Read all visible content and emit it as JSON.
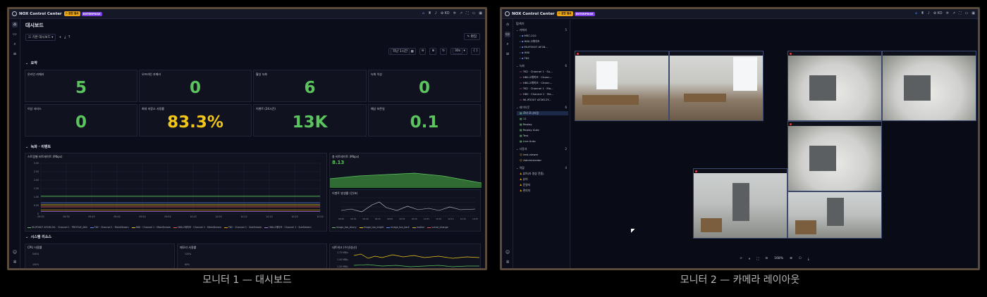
{
  "captions": {
    "monitor1": "모니터 1 — 대시보드",
    "monitor2": "모니터 2 — 카메라 레이아웃"
  },
  "app": {
    "title": "NOX Control Center",
    "badge_warn": "⚠ 권한 필요",
    "badge_edition": "ENTERPRISE",
    "lang": "KO"
  },
  "dashboard": {
    "title": "대시보드",
    "dashboard_select": "기본 대시보드",
    "edit_label": "편집",
    "time_range": "지난 1시간",
    "refresh": "30s",
    "sections": {
      "summary": "요약",
      "recording_events": "녹화 · 이벤트",
      "system_resources": "시스템 리소스"
    },
    "stats": [
      {
        "title": "온라인 카메라",
        "value": "5",
        "color": "green"
      },
      {
        "title": "오프라인 카메라",
        "value": "0",
        "color": "green"
      },
      {
        "title": "활성 녹화",
        "value": "6",
        "color": "green"
      },
      {
        "title": "녹화 이상",
        "value": "0",
        "color": "green"
      },
      {
        "title": "이상 서비스",
        "value": "0",
        "color": "green"
      },
      {
        "title": "최대 저장소 사용률",
        "value": "83.3%",
        "color": "yellow"
      },
      {
        "title": "이벤트 (24시간)",
        "value": "13K",
        "color": "green"
      },
      {
        "title": "예상 보존일",
        "value": "0.1",
        "color": "green"
      }
    ],
    "panels": {
      "stream_bitrate": "스트림별 비트레이트 (Mbps)",
      "total_bitrate": "총 비트레이트 (Mbps)",
      "total_bitrate_value": "8.13",
      "event_rate": "이벤트 발생률 (건/초)",
      "cpu": "CPU 사용률",
      "memory": "메모리 사용률",
      "net": "네트워크 (수신/송신)"
    },
    "bitrate_yticks": [
      "3.00",
      "2.50",
      "2.00",
      "1.50",
      "1.00",
      "0.50",
      "0"
    ],
    "time_ticks": [
      "09:30",
      "09:35",
      "09:40",
      "09:45",
      "09:50",
      "09:55",
      "10:00",
      "10:05",
      "10:10",
      "10:15",
      "10:20",
      "10:25"
    ],
    "event_time_ticks": [
      "09:30",
      "09:35",
      "09:40",
      "09:45",
      "09:50",
      "09:55",
      "10:00",
      "10:05",
      "10:10",
      "10:15",
      "10:20",
      "10:25"
    ],
    "stream_legend": [
      {
        "name": "MI-IP2007 AF2812VL · Channel 1 · PROFILE_000",
        "color": "#5cc45e"
      },
      {
        "name": "T62 · Channel 1 · MainStream",
        "color": "#5b8def"
      },
      {
        "name": "H80 · Channel 1 · MainStream",
        "color": "#f2c618"
      },
      {
        "name": "H80-2채미조 · Channel 1 · MainStream",
        "color": "#e05a5a"
      },
      {
        "name": "T62 · Channel 1 · SubStream",
        "color": "#e8a317"
      },
      {
        "name": "H80-2채미조 · Channel 1 · SubStream",
        "color": "#b072e8"
      }
    ],
    "event_legend": [
      {
        "name": "image_too_blurry",
        "color": "#5cc45e"
      },
      {
        "name": "image_too_bright",
        "color": "#f2c618"
      },
      {
        "name": "image_too_dark",
        "color": "#5b8def"
      },
      {
        "name": "motion",
        "color": "#e8a317"
      },
      {
        "name": "scene_change",
        "color": "#e05a5a"
      }
    ],
    "cpu_yticks": [
      "200%",
      "150%"
    ],
    "mem_yticks": [
      "120%",
      "80%"
    ],
    "net_yticks": [
      "1.75 MB/s",
      "1.40 MB/s",
      "1.20 MB/s"
    ]
  },
  "layout_view": {
    "explorer_title": "탐색기",
    "groups": {
      "cameras": {
        "label": "카메라",
        "count": "5"
      },
      "recordings": {
        "label": "녹화",
        "count": "6"
      },
      "layouts": {
        "label": "레이아웃",
        "count": "6"
      },
      "users": {
        "label": "사용자",
        "count": "2"
      },
      "roles": {
        "label": "역할",
        "count": "4"
      }
    },
    "cameras": [
      "MSC-210",
      "H80-2채미조",
      "MI-IP2007 AF28...",
      "H80",
      "T62"
    ],
    "recordings": [
      "T62 · Channel 1 · Su...",
      "H80-2채미조 · Chann...",
      "H80-2채미조 · Chann...",
      "T62 · Channel 1 · Ma...",
      "H80 · Channel 1 · Ma...",
      "MI-IP2007 AF2812Y..."
    ],
    "layouts": [
      "로비 모니터링",
      "11",
      "Replay",
      "Replay Auto",
      "Test",
      "Live Auto"
    ],
    "users": [
      "test-viewer",
      "Administrator"
    ],
    "roles": [
      "뷰어(라 영상 전용)",
      "뷰어",
      "운영자",
      "관리자"
    ],
    "zoom": "168%"
  }
}
